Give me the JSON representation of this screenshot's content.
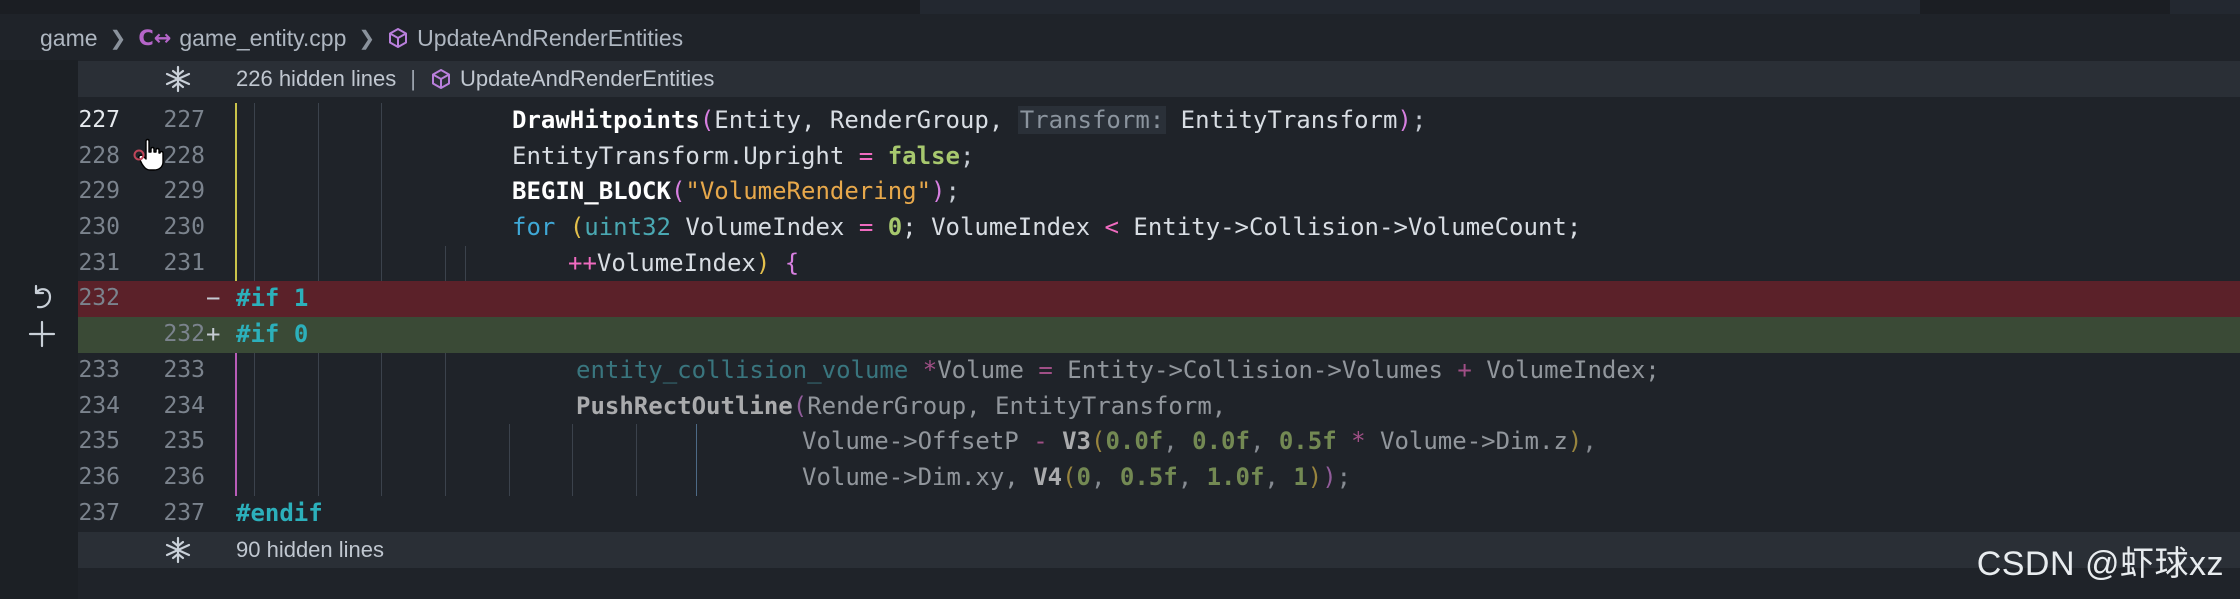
{
  "breadcrumb": {
    "folder": "game",
    "file": "game_entity.cpp",
    "symbol": "UpdateAndRenderEntities",
    "file_icon_glyph": "C↔",
    "file_icon": "cpp-file-icon",
    "symbol_icon": "cube-method-icon"
  },
  "fold_top": {
    "label": "226 hidden lines",
    "separator": "|",
    "symbol": "UpdateAndRenderEntities",
    "icon": "unfold-icon"
  },
  "fold_bottom": {
    "label": "90 hidden lines",
    "icon": "unfold-icon"
  },
  "lines": [
    {
      "old": "227",
      "new": "227"
    },
    {
      "old": "228",
      "new": "228"
    },
    {
      "old": "229",
      "new": "229"
    },
    {
      "old": "230",
      "new": "230"
    },
    {
      "old": "231",
      "new": "231"
    },
    {
      "old": "232",
      "new": "",
      "marker": "−"
    },
    {
      "old": "",
      "new": "232",
      "marker": "+"
    },
    {
      "old": "233",
      "new": "233"
    },
    {
      "old": "234",
      "new": "234"
    },
    {
      "old": "235",
      "new": "235"
    },
    {
      "old": "236",
      "new": "236"
    },
    {
      "old": "237",
      "new": "237"
    }
  ],
  "code": {
    "l227": {
      "fn": "DrawHitpoints",
      "a": "Entity, RenderGroup, ",
      "hint": "Transform:",
      "b": " EntityTransform",
      "end": ";"
    },
    "l228": {
      "a": "EntityTransform.Upright ",
      "eq": "=",
      "val": "false",
      "end": ";"
    },
    "l229": {
      "fn": "BEGIN_BLOCK",
      "str": "\"VolumeRendering\"",
      "end": ";"
    },
    "l230": {
      "kw": "for",
      "ty": "uint32",
      "a": " VolumeIndex ",
      "eq": "=",
      "zero": "0",
      "b": "; VolumeIndex ",
      "lt": "<",
      "c": " Entity->Collision->VolumeCount;"
    },
    "l231": {
      "inc": "++",
      "a": "VolumeIndex",
      "b": " {"
    },
    "l232_removed": {
      "pp": "#if",
      "num": "1"
    },
    "l232_added": {
      "pp": "#if",
      "num": "0"
    },
    "l233": {
      "ty": "entity_collision_volume ",
      "star": "*",
      "a": "Volume ",
      "eq": "=",
      "b": " Entity->Collision->Volumes ",
      "plus": "+",
      "c": " VolumeIndex;"
    },
    "l234": {
      "fn": "PushRectOutline",
      "a": "RenderGroup, EntityTransform,"
    },
    "l235": {
      "a": "Volume->OffsetP ",
      "minus": "-",
      "fn": "V3",
      "n1": "0.0f",
      "n2": "0.0f",
      "n3": "0.5f",
      "star": "*",
      "b": " Volume->Dim.z",
      "end": ","
    },
    "l236": {
      "a": "Volume->Dim.xy, ",
      "fn": "V4",
      "n1": "0",
      "n2": "0.5f",
      "n3": "1.0f",
      "n4": "1",
      "end": ";"
    },
    "l237": {
      "pp": "#endif"
    }
  },
  "side_icons": {
    "revert": "revert-icon",
    "add": "add-icon"
  },
  "watermark": "CSDN @虾球xz",
  "colors": {
    "background": "#1f2329",
    "removed_line": "#5b2129",
    "added_line": "#3a4a36",
    "keyword": "#3fa8d6",
    "string": "#e7a84b",
    "number": "#a7c86e",
    "operator": "#f06bc0",
    "preprocessor": "#2cb0bb"
  }
}
